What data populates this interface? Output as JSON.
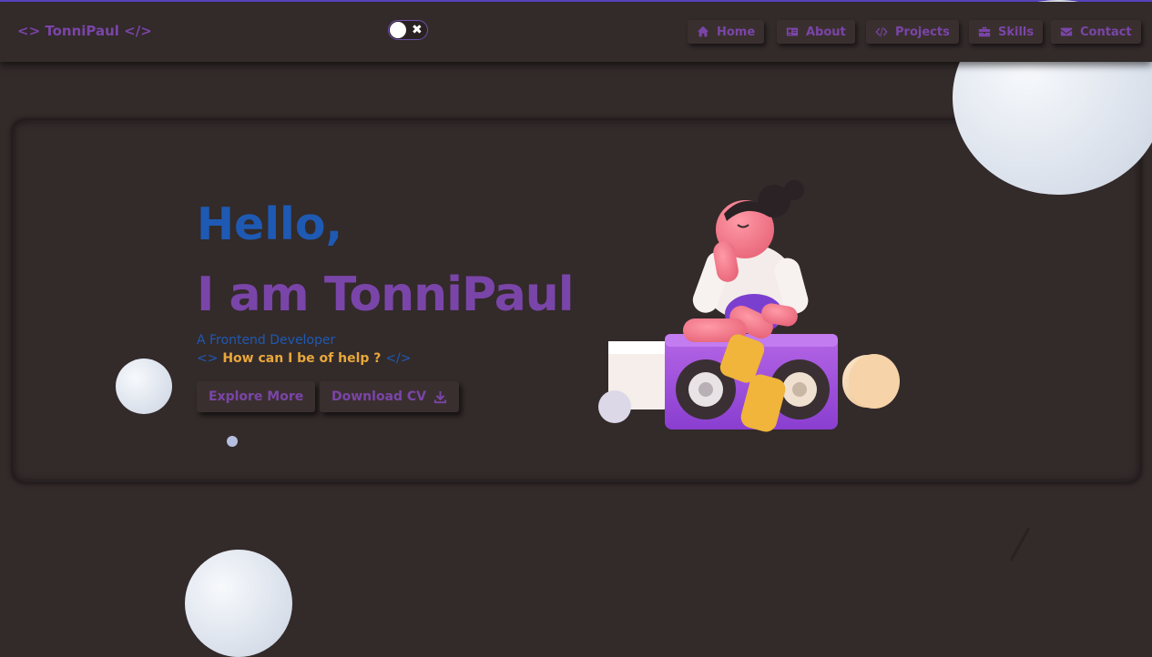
{
  "navbar": {
    "logo": "<> TonniPaul </>",
    "theme_toggle_symbol": "✖",
    "items": [
      {
        "label": "Home",
        "icon": "home-icon"
      },
      {
        "label": "About",
        "icon": "id-card-icon"
      },
      {
        "label": "Projects",
        "icon": "code-icon"
      },
      {
        "label": "Skills",
        "icon": "toolbox-icon"
      },
      {
        "label": "Contact",
        "icon": "envelope-icon"
      }
    ]
  },
  "hero": {
    "greeting": "Hello,",
    "headline": "I am TonniPaul",
    "role": "A Frontend Developer",
    "help_open_tag": "<>",
    "help_text": "How can I be of help ?",
    "help_close_tag": "</>",
    "explore_label": "Explore More",
    "download_label": "Download CV",
    "illustration": "girl-on-speaker-illustration"
  },
  "colors": {
    "background": "#332a2a",
    "accent_purple": "#7a45a8",
    "accent_blue": "#1e5ab3",
    "accent_orange": "#e8a83b"
  }
}
